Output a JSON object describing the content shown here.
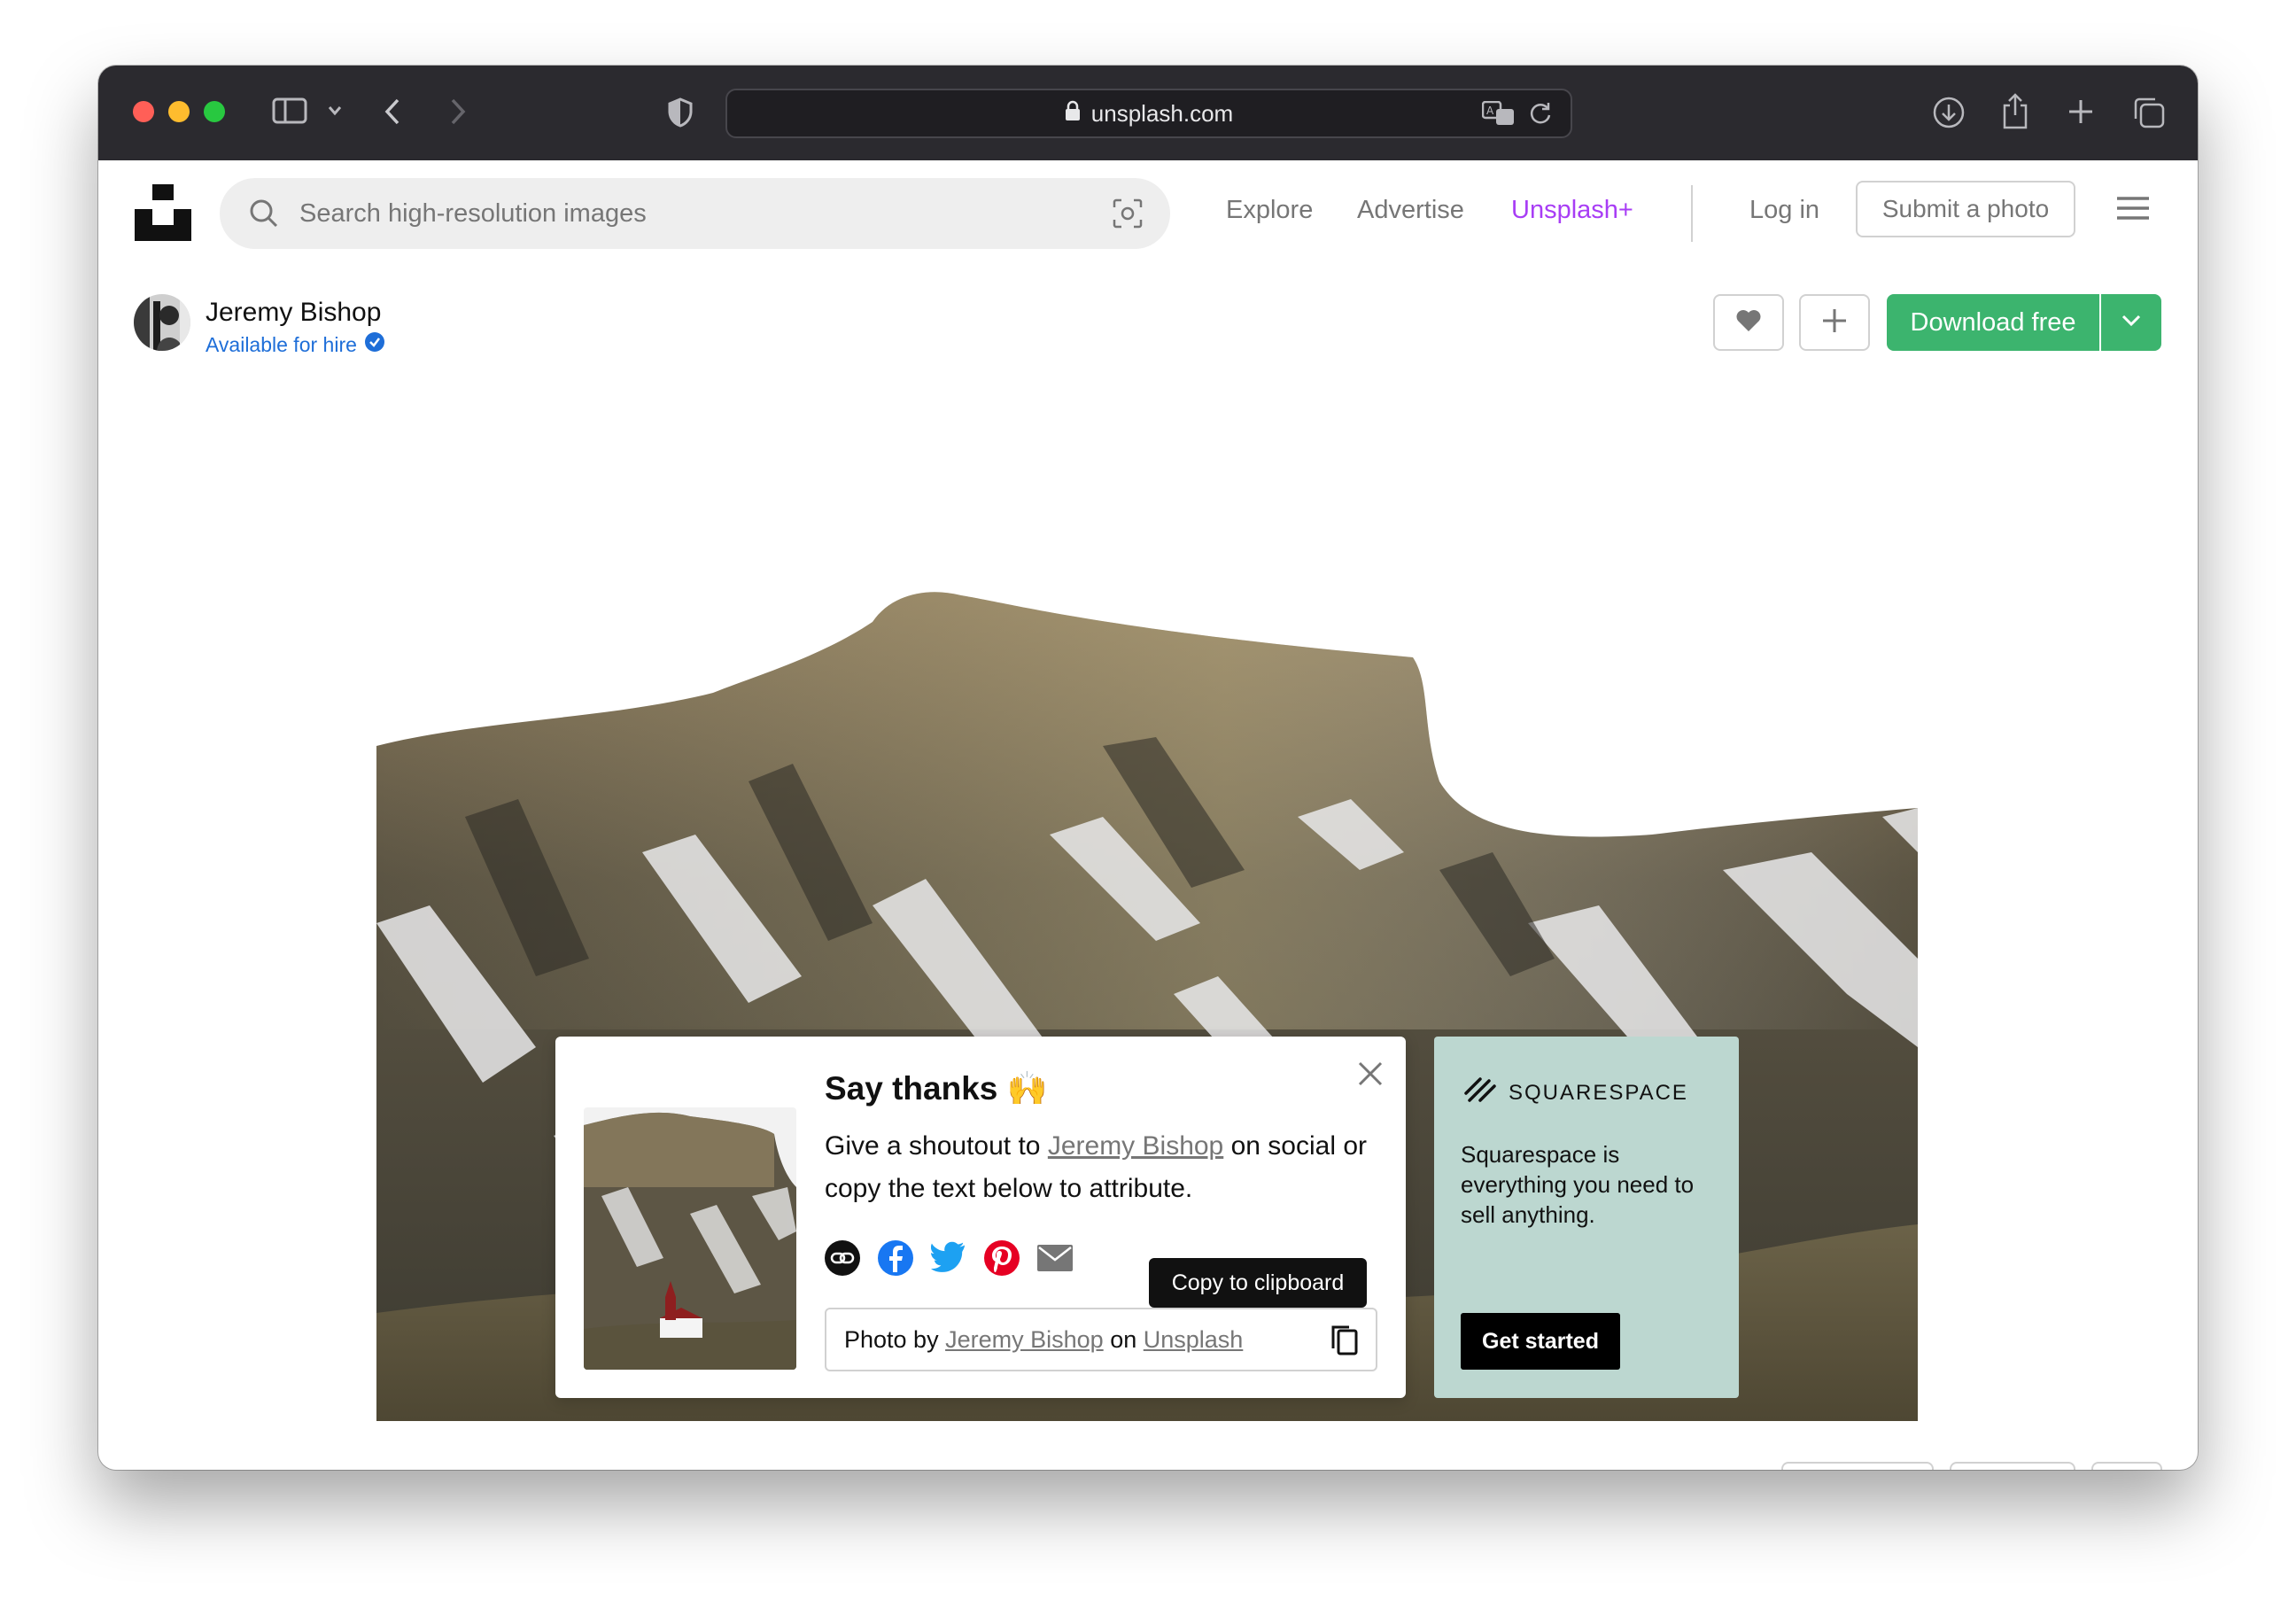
{
  "browser": {
    "url": "unsplash.com",
    "traffic_lights": [
      "#ff5f57",
      "#febc2e",
      "#28c840"
    ]
  },
  "header": {
    "search_placeholder": "Search high-resolution images",
    "nav": {
      "explore": "Explore",
      "advertise": "Advertise",
      "unsplash_plus": "Unsplash+",
      "login": "Log in",
      "submit": "Submit a photo"
    }
  },
  "author": {
    "name": "Jeremy Bishop",
    "hire": "Available for hire"
  },
  "actions": {
    "download": "Download free",
    "accent": "#3cb46e"
  },
  "modal": {
    "title": "Say thanks 🙌",
    "text_before": "Give a shoutout to ",
    "author_link": "Jeremy Bishop",
    "text_after": " on social or copy the text below to attribute.",
    "attrib_prefix": "Photo by ",
    "attrib_author": "Jeremy Bishop",
    "attrib_mid": " on ",
    "attrib_site": "Unsplash",
    "tooltip": "Copy to clipboard",
    "share_icons": [
      "link-icon",
      "facebook-icon",
      "twitter-icon",
      "pinterest-icon",
      "email-icon"
    ]
  },
  "ad": {
    "brand": "SQUARESPACE",
    "text": "Squarespace is everything you need to sell anything.",
    "cta": "Get started",
    "bg": "#bcd7d0"
  }
}
